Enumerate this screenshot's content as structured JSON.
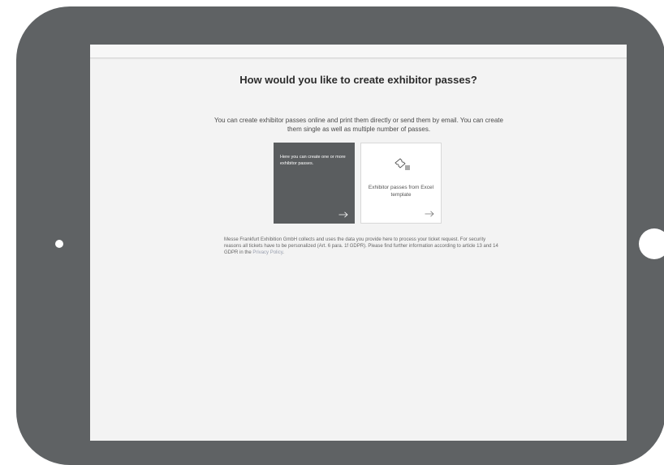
{
  "page": {
    "title": "How would you like to create exhibitor passes?",
    "intro": "You can create exhibitor passes online and print them directly or send them by email. You can create them single as well as multiple number of passes."
  },
  "options": [
    {
      "text": "Here you can create one or more exhibitor passes.",
      "arrow_icon": "arrow-right-icon",
      "colors": {
        "background": "#5a5d5f",
        "text": "#ffffff"
      }
    },
    {
      "text": "Exhibitor passes from Excel template",
      "icon": "ticket-list-icon",
      "arrow_icon": "arrow-right-icon",
      "colors": {
        "background": "#ffffff",
        "text": "#555555"
      }
    }
  ],
  "legal": {
    "text": "Messe Frankfurt Exhibition GmbH collects and uses the data you provide here to process your ticket request. For security reasons all tickets have to be personalized (Art. 6 para. 1f GDPR). Please find further information according to article 13 and 14 GDPR in the",
    "link_label": "Privacy Policy",
    "end": "."
  },
  "device": {
    "frame_color": "#5f6264",
    "screen_color": "#f3f3f3"
  }
}
